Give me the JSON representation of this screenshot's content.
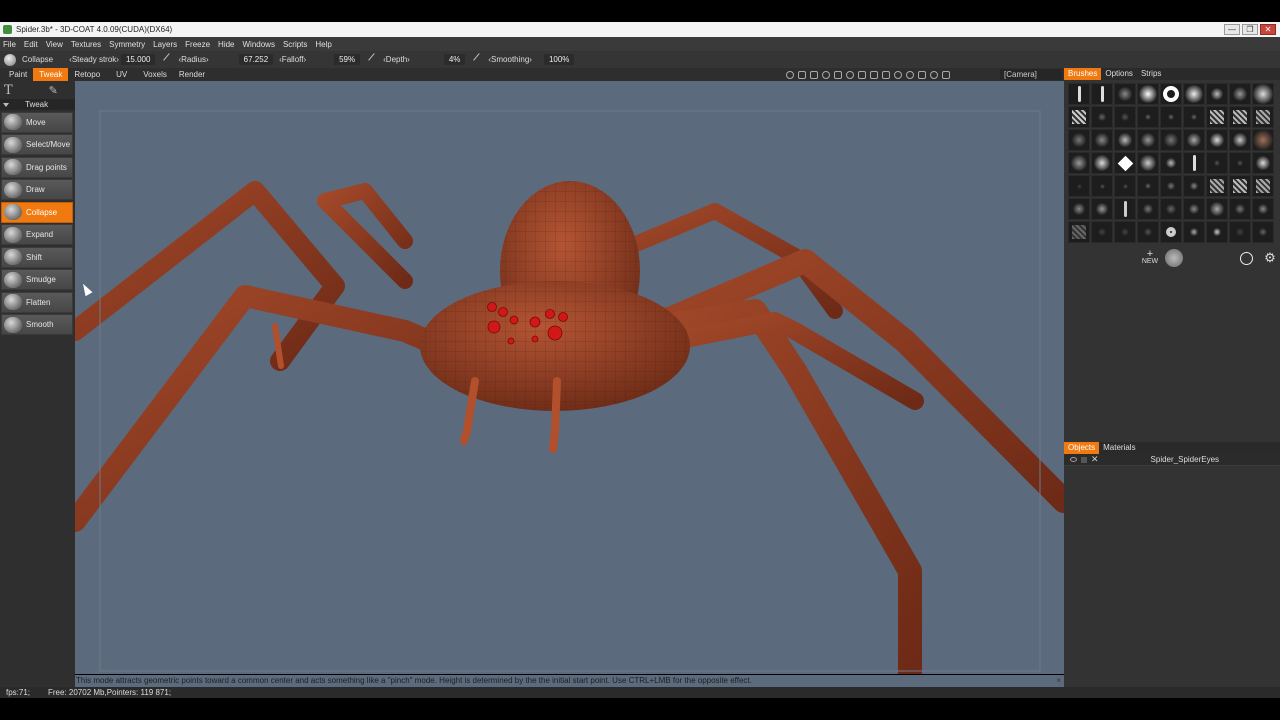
{
  "window": {
    "title": "Spider.3b* - 3D-COAT 4.0.09(CUDA)(DX64)",
    "controls": [
      "—",
      "❐",
      "✕"
    ]
  },
  "menu": [
    "File",
    "Edit",
    "View",
    "Textures",
    "Symmetry",
    "Layers",
    "Freeze",
    "Hide",
    "Windows",
    "Scripts",
    "Help"
  ],
  "toolbar": {
    "current_tool": "Collapse",
    "steady_label": "Steady",
    "stroke_label": "strok",
    "stroke_value": "15.000",
    "radius_label": "‹Radius›",
    "radius_value": "67.252",
    "falloff_label": "‹Falloff›",
    "falloff_value": "59%",
    "depth_label": "‹Depth›",
    "depth_value": "4%",
    "smoothing_label": "‹Smoothing›",
    "smoothing_value": "100%"
  },
  "rooms": [
    "Paint",
    "Tweak",
    "Retopo",
    "UV",
    "Voxels",
    "Render"
  ],
  "active_room": "Tweak",
  "camera": "[Camera]",
  "tools_section": "Tweak",
  "tools": [
    "Move",
    "Select/Move",
    "Drag points",
    "Draw",
    "Collapse",
    "Expand",
    "Shift",
    "Smudge",
    "Flatten",
    "Smooth"
  ],
  "active_tool": "Collapse",
  "right_tabs": [
    "Brushes",
    "Options",
    "Strips"
  ],
  "right_active_tab": "Brushes",
  "brush_new_label": "NEW",
  "object_tabs": [
    "Objects",
    "Materials"
  ],
  "object_active_tab": "Objects",
  "objects": [
    "Spider_SpiderEyes"
  ],
  "status_message": "This mode attracts geometric points toward a common center and acts something like a \"pinch\" mode. Height is determined by the the initial start point. Use CTRL+LMB for the opposite effect.",
  "fps": "fps:71;",
  "memory": "Free: 20702 Mb,Pointers: 119 871;",
  "colors": {
    "accent": "#f07a10",
    "viewport": "#5b6a7c",
    "spider": "#8a3a22",
    "eyes": "#d01818"
  }
}
